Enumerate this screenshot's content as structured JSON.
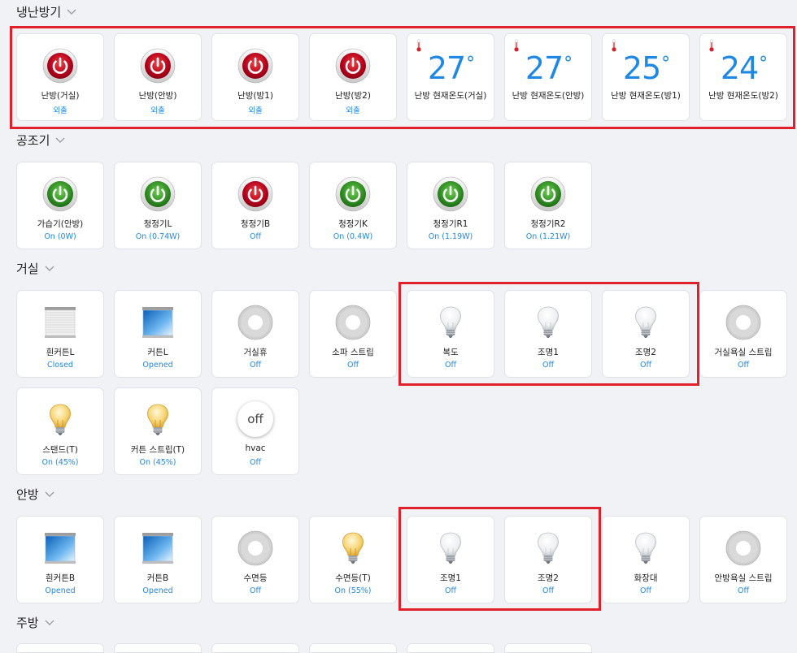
{
  "sections": {
    "heating": {
      "title": "냉난방기"
    },
    "air": {
      "title": "공조기"
    },
    "living": {
      "title": "거실"
    },
    "master": {
      "title": "안방"
    },
    "kitchen": {
      "title": "주방"
    }
  },
  "heating": {
    "power": [
      {
        "label": "난방(거실)",
        "status": "외출"
      },
      {
        "label": "난방(안방)",
        "status": "외출"
      },
      {
        "label": "난방(방1)",
        "status": "외출"
      },
      {
        "label": "난방(방2)",
        "status": "외출"
      }
    ],
    "temps": [
      {
        "value": "27",
        "unit": "°",
        "label": "난방 현재온도(거실)"
      },
      {
        "value": "27",
        "unit": "°",
        "label": "난방 현재온도(안방)"
      },
      {
        "value": "25",
        "unit": "°",
        "label": "난방 현재온도(방1)"
      },
      {
        "value": "24",
        "unit": "°",
        "label": "난방 현재온도(방2)"
      }
    ]
  },
  "air": [
    {
      "label": "가습기(안방)",
      "status": "On (0W)",
      "state": "on"
    },
    {
      "label": "청정기L",
      "status": "On (0.74W)",
      "state": "on"
    },
    {
      "label": "청정기B",
      "status": "Off",
      "state": "off"
    },
    {
      "label": "청정기K",
      "status": "On (0.4W)",
      "state": "on"
    },
    {
      "label": "청정기R1",
      "status": "On (1.19W)",
      "state": "on"
    },
    {
      "label": "청정기R2",
      "status": "On (1.21W)",
      "state": "on"
    }
  ],
  "living": [
    {
      "label": "흰커튼L",
      "status": "Closed",
      "icon": "curtain-closed-icon"
    },
    {
      "label": "커튼L",
      "status": "Opened",
      "icon": "curtain-open-icon"
    },
    {
      "label": "거실휴",
      "status": "Off",
      "icon": "switch-icon"
    },
    {
      "label": "소파 스트립",
      "status": "Off",
      "icon": "switch-icon"
    },
    {
      "label": "복도",
      "status": "Off",
      "icon": "bulb-off-icon"
    },
    {
      "label": "조명1",
      "status": "Off",
      "icon": "bulb-off-icon"
    },
    {
      "label": "조명2",
      "status": "Off",
      "icon": "bulb-off-icon"
    },
    {
      "label": "거실욕실 스트립",
      "status": "Off",
      "icon": "switch-icon"
    },
    {
      "label": "스탠드(T)",
      "status": "On (45%)",
      "icon": "bulb-on-icon"
    },
    {
      "label": "커튼 스트립(T)",
      "status": "On (45%)",
      "icon": "bulb-on-icon"
    },
    {
      "label": "hvac",
      "status": "Off",
      "icon": "off-badge-icon",
      "badge": "off"
    }
  ],
  "master": [
    {
      "label": "흰커튼B",
      "status": "Opened",
      "icon": "curtain-open-icon"
    },
    {
      "label": "커튼B",
      "status": "Opened",
      "icon": "curtain-open-icon"
    },
    {
      "label": "수면등",
      "status": "Off",
      "icon": "switch-icon"
    },
    {
      "label": "수면등(T)",
      "status": "On (55%)",
      "icon": "bulb-on-icon"
    },
    {
      "label": "조명1",
      "status": "Off",
      "icon": "bulb-off-icon"
    },
    {
      "label": "조명2",
      "status": "Off",
      "icon": "bulb-off-icon"
    },
    {
      "label": "화장대",
      "status": "Off",
      "icon": "bulb-off-icon"
    },
    {
      "label": "안방욕실 스트립",
      "status": "Off",
      "icon": "switch-icon"
    }
  ],
  "colors": {
    "accent": "#1e88e5",
    "highlight": "#e0202a",
    "power_on": "#3f9a2f",
    "power_off": "#c8102e"
  }
}
